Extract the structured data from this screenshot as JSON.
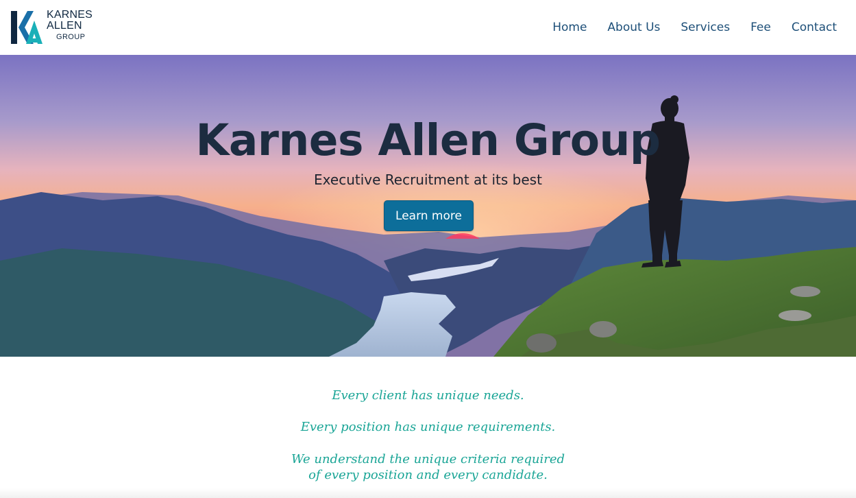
{
  "brand": {
    "line1": "KARNES",
    "line2": "ALLEN",
    "line3": "GROUP",
    "colors": {
      "navy": "#0f2740",
      "teal": "#1ab0b8",
      "blue": "#1a6fa8"
    }
  },
  "nav": {
    "items": [
      {
        "label": "Home"
      },
      {
        "label": "About Us"
      },
      {
        "label": "Services"
      },
      {
        "label": "Fee"
      },
      {
        "label": "Contact"
      }
    ],
    "color": "#1d4f78"
  },
  "hero": {
    "title": "Karnes Allen Group",
    "subtitle": "Executive Recruitment at its best",
    "cta_label": "Learn more",
    "cta_color": "#0d6e9a",
    "image": "mountain lake sunset with hiker silhouette"
  },
  "tagline": {
    "line1": "Every client has unique needs.",
    "line2": "Every position has unique requirements.",
    "line3a": "We understand the unique criteria required",
    "line3b": "of every position and every candidate.",
    "color": "#1aa596"
  }
}
